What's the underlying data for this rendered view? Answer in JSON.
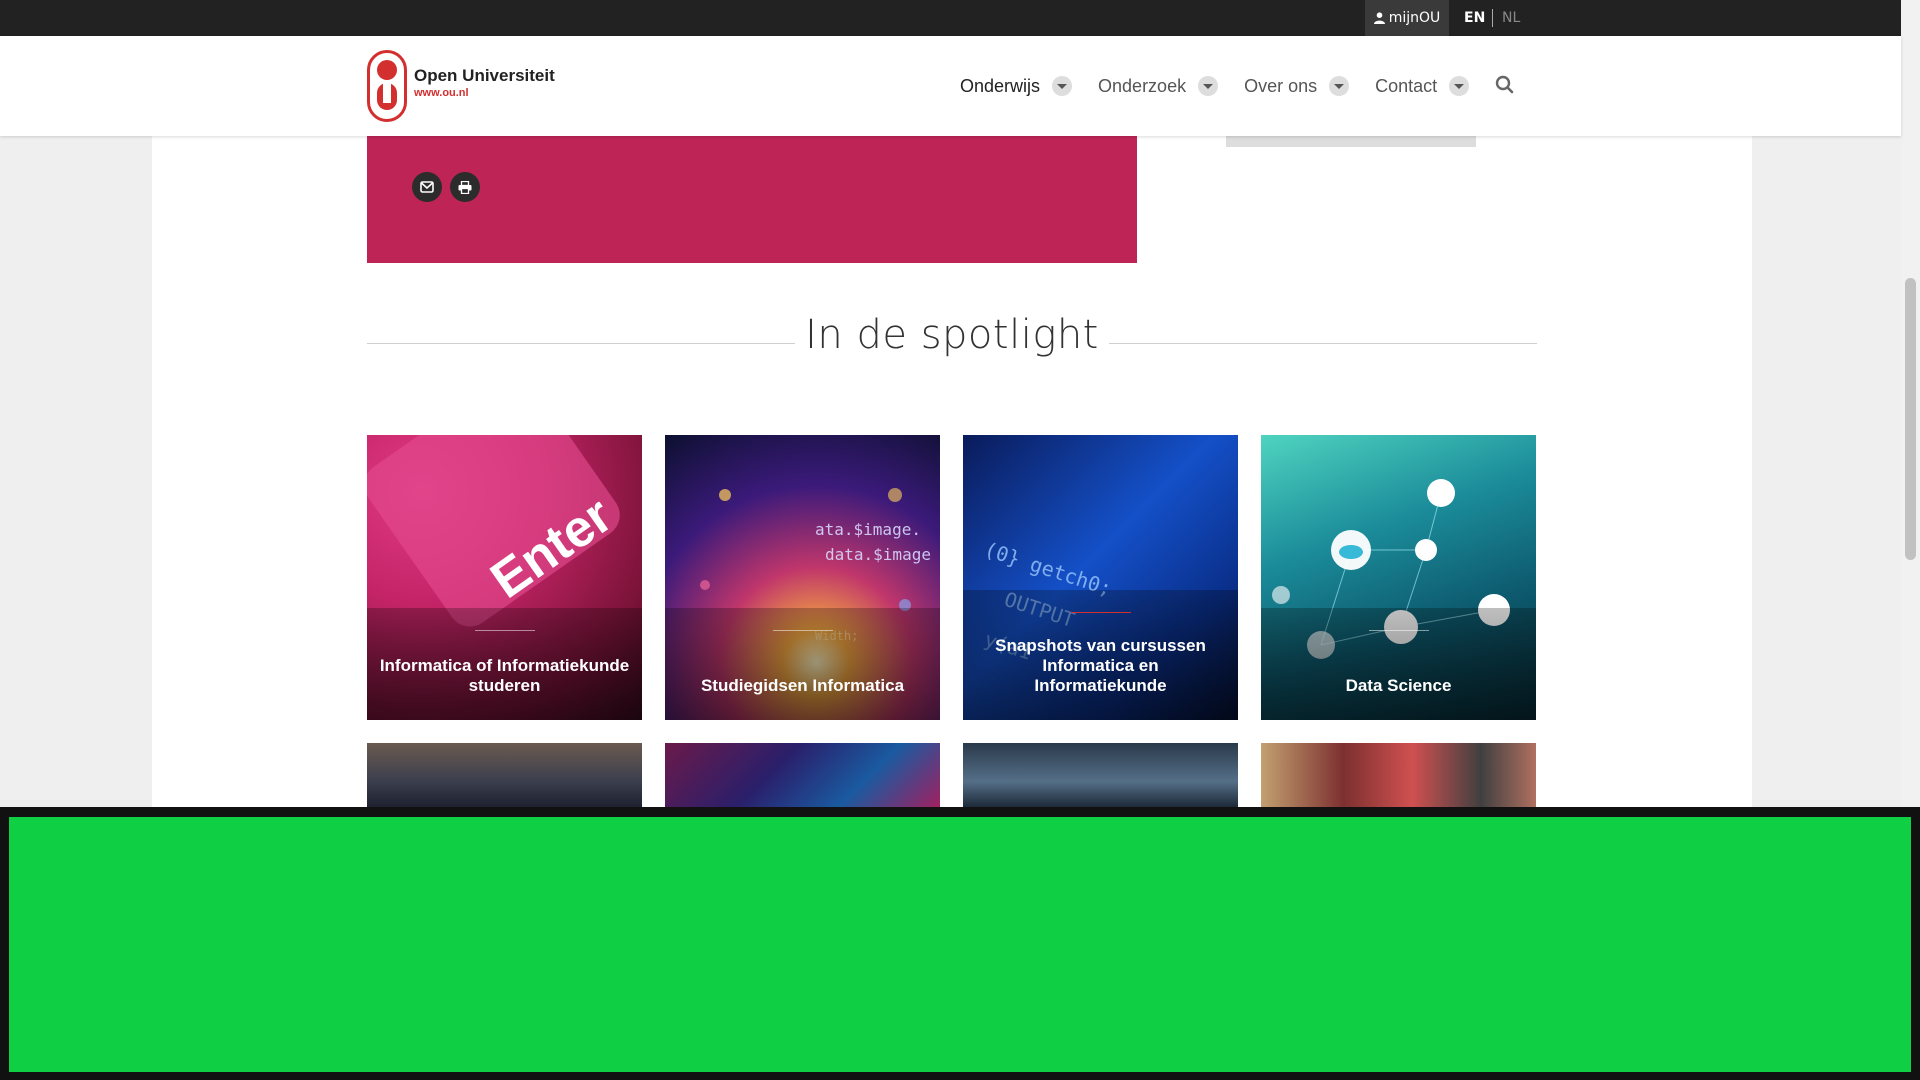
{
  "utility_bar": {
    "account_label": "mijnOU",
    "lang_en": "EN",
    "lang_nl": "NL"
  },
  "logo": {
    "title": "Open Universiteit",
    "url": "www.ou.nl"
  },
  "nav": {
    "items": [
      {
        "label": "Onderwijs"
      },
      {
        "label": "Onderzoek"
      },
      {
        "label": "Over ons"
      },
      {
        "label": "Contact"
      }
    ]
  },
  "spotlight": {
    "title": "In de spotlight",
    "tiles": [
      {
        "title": "Informatica of Informatiekunde studeren"
      },
      {
        "title": "Studiegidsen Informatica"
      },
      {
        "title": "Snapshots van cursussen Informatica en Informatiekunde"
      },
      {
        "title": "Data Science"
      }
    ]
  },
  "colors": {
    "brand_red": "#d32f2f",
    "magenta_block": "#be2556",
    "green_overlay": "#0fcf45"
  }
}
